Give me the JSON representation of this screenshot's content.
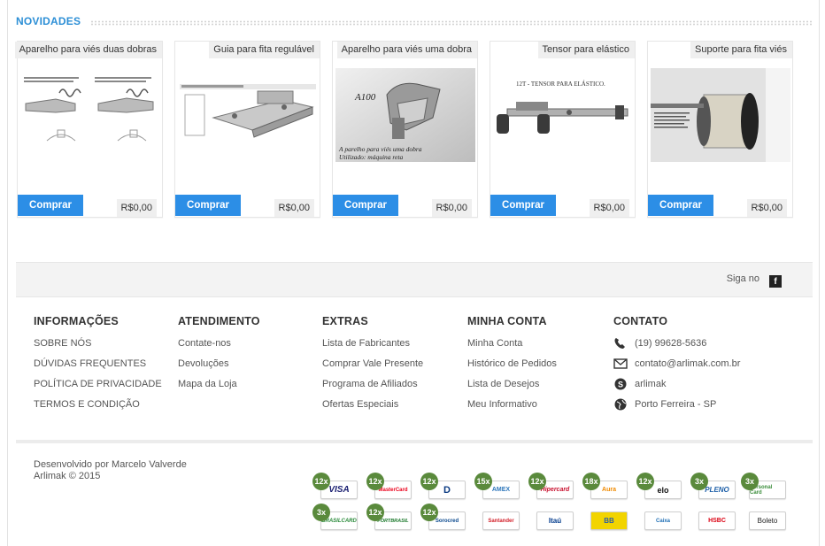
{
  "section": {
    "title": "NOVIDADES"
  },
  "products": [
    {
      "name": "Aparelho para viés duas dobras",
      "price": "R$0,00",
      "buy_label": "Comprar"
    },
    {
      "name": "Guia para fita regulável",
      "price": "R$0,00",
      "buy_label": "Comprar"
    },
    {
      "name": "Aparelho para viés uma dobra",
      "price": "R$0,00",
      "buy_label": "Comprar",
      "img_caption": "A100",
      "img_text_1": "A parelho para viés uma dobra",
      "img_text_2": "Utilizado: máquina reta"
    },
    {
      "name": "Tensor para elástico",
      "price": "R$0,00",
      "buy_label": "Comprar",
      "img_caption": "12T - TENSOR PARA ELÁSTICO."
    },
    {
      "name": "Suporte para fita viés",
      "price": "R$0,00",
      "buy_label": "Comprar"
    }
  ],
  "social": {
    "label": "Siga no",
    "facebook_icon": "facebook-icon"
  },
  "footer": {
    "columns": [
      {
        "title": "INFORMAÇÕES",
        "links": [
          "SOBRE NÓS",
          "DÚVIDAS FREQUENTES",
          "POLÍTICA DE PRIVACIDADE",
          "TERMOS E CONDIÇÃO"
        ]
      },
      {
        "title": "ATENDIMENTO",
        "links": [
          "Contate-nos",
          "Devoluções",
          "Mapa da Loja"
        ]
      },
      {
        "title": "EXTRAS",
        "links": [
          "Lista de Fabricantes",
          "Comprar Vale Presente",
          "Programa de Afiliados",
          "Ofertas Especiais"
        ]
      },
      {
        "title": "MINHA CONTA",
        "links": [
          "Minha Conta",
          "Histórico de Pedidos",
          "Lista de Desejos",
          "Meu Informativo"
        ]
      }
    ],
    "contact": {
      "title": "CONTATO",
      "items": [
        {
          "icon": "phone-icon",
          "text": "(19) 99628-5636"
        },
        {
          "icon": "mail-icon",
          "text": "contato@arlimak.com.br"
        },
        {
          "icon": "skype-icon",
          "text": "arlimak"
        },
        {
          "icon": "globe-icon",
          "text": "Porto Ferreira - SP"
        }
      ]
    },
    "credits": {
      "line1": "Desenvolvido por Marcelo Valverde",
      "line2": "Arlimak © 2015"
    },
    "payments_row1": [
      {
        "name": "VISA",
        "badge": "12x",
        "color": "#1a1f71"
      },
      {
        "name": "MasterCard",
        "badge": "12x",
        "color": "#eb001b"
      },
      {
        "name": "D",
        "badge": "12x",
        "color": "#0a3a82"
      },
      {
        "name": "AMEX",
        "badge": "15x",
        "color": "#2e77bb"
      },
      {
        "name": "Hipercard",
        "badge": "12x",
        "color": "#c8102e"
      },
      {
        "name": "Aura",
        "badge": "18x",
        "color": "#f08a00"
      },
      {
        "name": "elo",
        "badge": "12x",
        "color": "#111111"
      },
      {
        "name": "PLENO",
        "badge": "3x",
        "color": "#1d5fa8"
      },
      {
        "name": "Personal Card",
        "badge": "3x",
        "color": "#3b8d3b"
      }
    ],
    "payments_row2": [
      {
        "name": "BRASILCARD",
        "badge": "3x",
        "color": "#2a8a3a"
      },
      {
        "name": "FORTBRASIL",
        "badge": "12x",
        "color": "#1e7a2e"
      },
      {
        "name": "Sorocred",
        "badge": "12x",
        "color": "#0c4a8e"
      },
      {
        "name": "Santander",
        "badge": "",
        "color": "#d3202a"
      },
      {
        "name": "Itaú",
        "badge": "",
        "color": "#003a8c"
      },
      {
        "name": "BB",
        "badge": "",
        "color": "#f2d400"
      },
      {
        "name": "Caixa",
        "badge": "",
        "color": "#1f6fb5"
      },
      {
        "name": "HSBC",
        "badge": "",
        "color": "#db0011"
      },
      {
        "name": "Boleto",
        "badge": "",
        "color": "#222222"
      }
    ]
  }
}
